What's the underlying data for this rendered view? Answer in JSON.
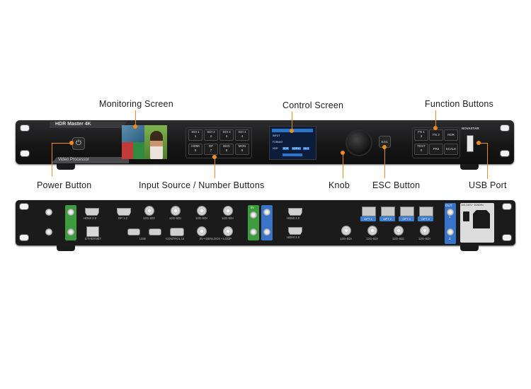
{
  "callouts": {
    "monitoring_screen": "Monitoring Screen",
    "control_screen": "Control Screen",
    "function_buttons": "Function Buttons",
    "power_button": "Power Button",
    "input_source_buttons": "Input Source / Number Buttons",
    "knob": "Knob",
    "esc_button": "ESC Button",
    "usb_port": "USB Port"
  },
  "front_panel": {
    "product_name": "HDR Master 4K",
    "subtitle": "Video Processor",
    "brand": "NOVASTAR",
    "input_buttons": [
      {
        "top": "SDI 1",
        "bottom": "1"
      },
      {
        "top": "SDI 2",
        "bottom": "2"
      },
      {
        "top": "SDI 3",
        "bottom": "3"
      },
      {
        "top": "SDI 4",
        "bottom": "4"
      },
      {
        "top": "HDMI",
        "bottom": "5"
      },
      {
        "top": "DP",
        "bottom": "7"
      },
      {
        "top": "BKG",
        "bottom": "8"
      },
      {
        "top": "MON",
        "bottom": "9"
      }
    ],
    "function_buttons": [
      {
        "top": "FN 1",
        "bottom": "3"
      },
      {
        "top": "FN 2",
        "bottom": ""
      },
      {
        "top": "HDR",
        "bottom": ""
      },
      {
        "top": "TEST",
        "bottom": "0"
      },
      {
        "top": "PR2",
        "bottom": ""
      },
      {
        "top": "SCALE",
        "bottom": ""
      }
    ],
    "esc_label": "ESC",
    "lcd_lines": [
      "INPUT",
      "FORMAT",
      "HDR",
      "SDR",
      "HDR10",
      "HLG"
    ],
    "power_icon": "power-icon"
  },
  "rear_panel": {
    "labels_top": [
      "HDMI 2.0",
      "DP 1.2",
      "12G-SDI",
      "12G-SDI",
      "12G-SDI",
      "12G-SDI"
    ],
    "labels_bottom": [
      "ETHERNET",
      "USB",
      "CONTROL UI",
      "IN • GENLOCK • LOOP"
    ],
    "in_label": "IN",
    "out_label": "OUT",
    "out_hdmi": [
      "HDMI 2.0",
      "HDMI 2.0"
    ],
    "opt_labels": [
      "OPT 1",
      "OPT 2",
      "OPT 3",
      "OPT 4"
    ],
    "out_sdi": [
      "12G-SDI",
      "12G-SDI",
      "12G-SDI",
      "12G-SDI"
    ],
    "out_numbers": [
      "1",
      "2"
    ],
    "power_rating": "100-240V~ 50/60Hz"
  },
  "colors": {
    "accent": "#f08a1c",
    "green_port": "#3d9a3d",
    "blue_port": "#3874c8",
    "opt_blue": "#3d7fd0"
  }
}
